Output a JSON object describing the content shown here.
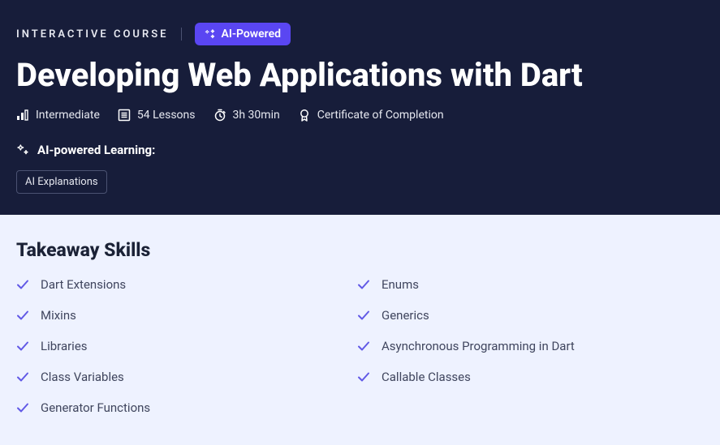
{
  "hero": {
    "kicker": "INTERACTIVE COURSE",
    "ai_badge": "AI-Powered",
    "title": "Developing Web Applications with Dart",
    "meta": {
      "level": "Intermediate",
      "lessons": "54 Lessons",
      "duration": "3h 30min",
      "certificate": "Certificate of Completion"
    },
    "ai_learning_label": "AI-powered Learning:",
    "tags": [
      "AI Explanations"
    ]
  },
  "skills": {
    "heading": "Takeaway Skills",
    "left": [
      "Dart Extensions",
      "Mixins",
      "Libraries",
      "Class Variables",
      "Generator Functions"
    ],
    "right": [
      "Enums",
      "Generics",
      "Asynchronous Programming in Dart",
      "Callable Classes"
    ]
  }
}
